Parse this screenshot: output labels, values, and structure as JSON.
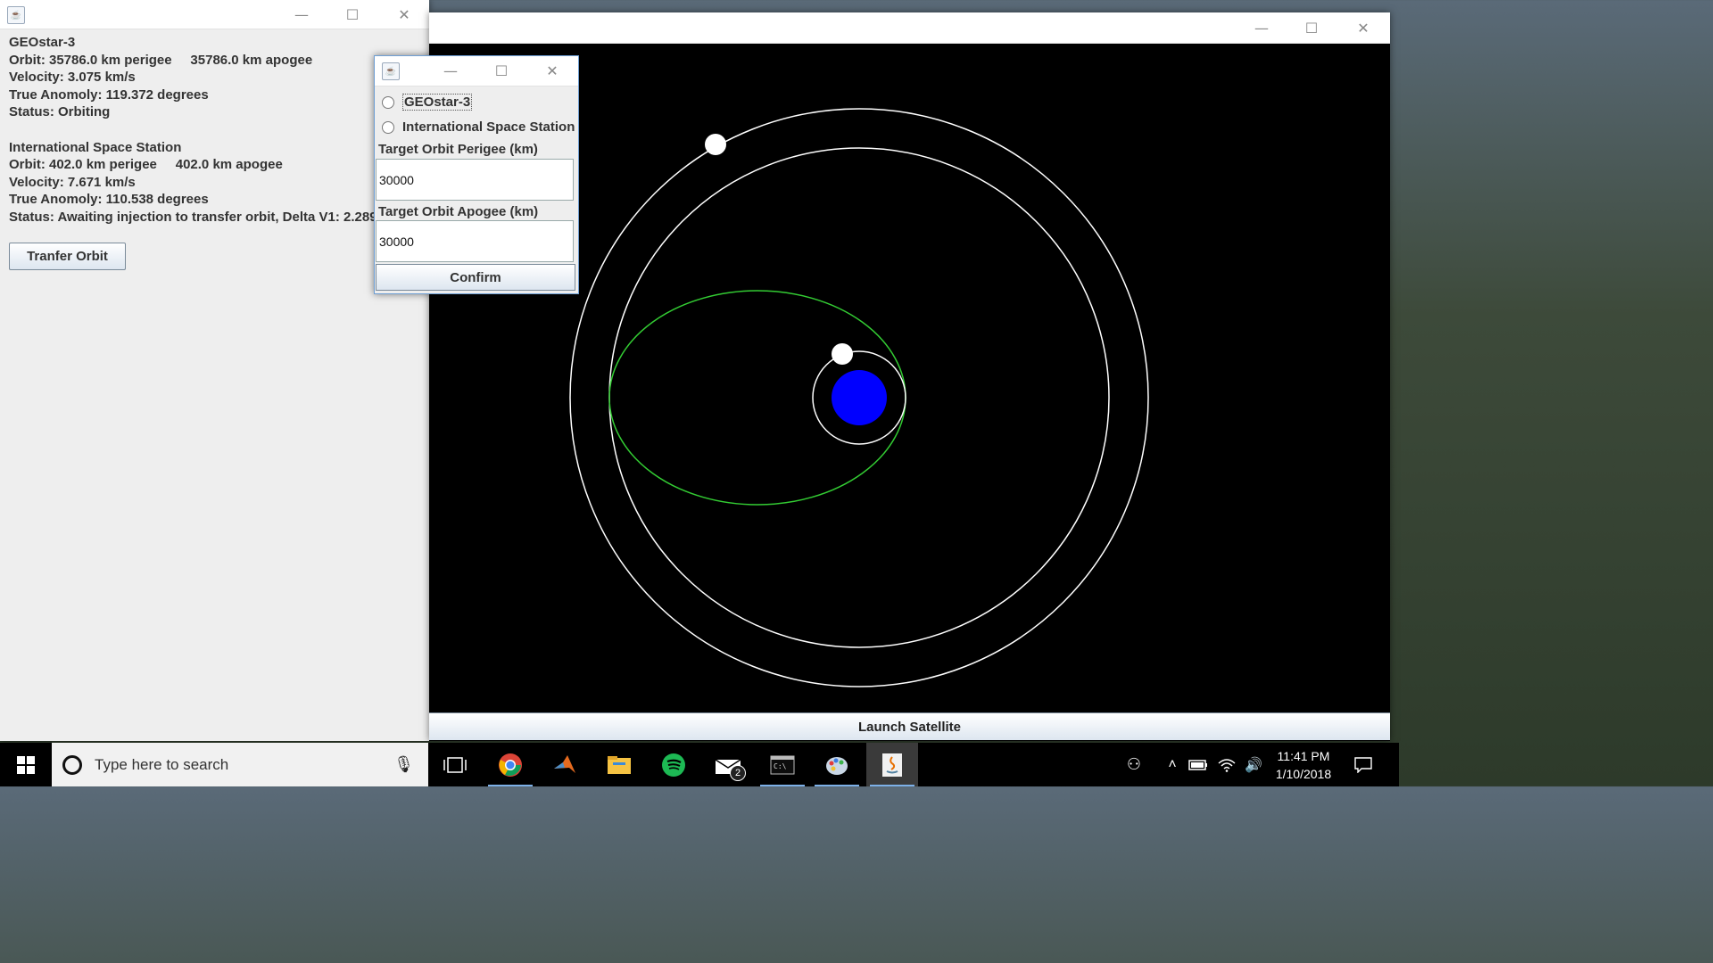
{
  "orbit_window": {
    "title": "",
    "launch_button": "Launch Satellite",
    "planet_color": "#0000ff",
    "orbit_color": "#ffffff",
    "transfer_orbit_color": "#33cc33"
  },
  "info_window": {
    "title": "",
    "satellites": [
      {
        "name": "GEOstar-3",
        "orbit": "Orbit: 35786.0 km perigee     35786.0 km apogee",
        "velocity": "Velocity: 3.075 km/s",
        "anomaly": "True Anomoly: 119.372 degrees",
        "status": "Status: Orbiting"
      },
      {
        "name": "International Space Station",
        "orbit": "Orbit: 402.0 km perigee     402.0 km apogee",
        "velocity": "Velocity: 7.671 km/s",
        "anomaly": "True Anomoly: 110.538 degrees",
        "status": "Status: Awaiting injection to transfer orbit, Delta V1:  2.289"
      }
    ],
    "transfer_button": "Tranfer Orbit"
  },
  "dialog": {
    "options": [
      "GEOstar-3",
      "International Space Station"
    ],
    "perigee_label": "Target Orbit Perigee (km)",
    "perigee_value": "30000",
    "apogee_label": "Target Orbit Apogee (km)",
    "apogee_value": "30000",
    "confirm_button": "Confirm"
  },
  "taskbar": {
    "search_placeholder": "Type here to search",
    "time": "11:41 PM",
    "date": "1/10/2018",
    "mail_badge": "2"
  }
}
